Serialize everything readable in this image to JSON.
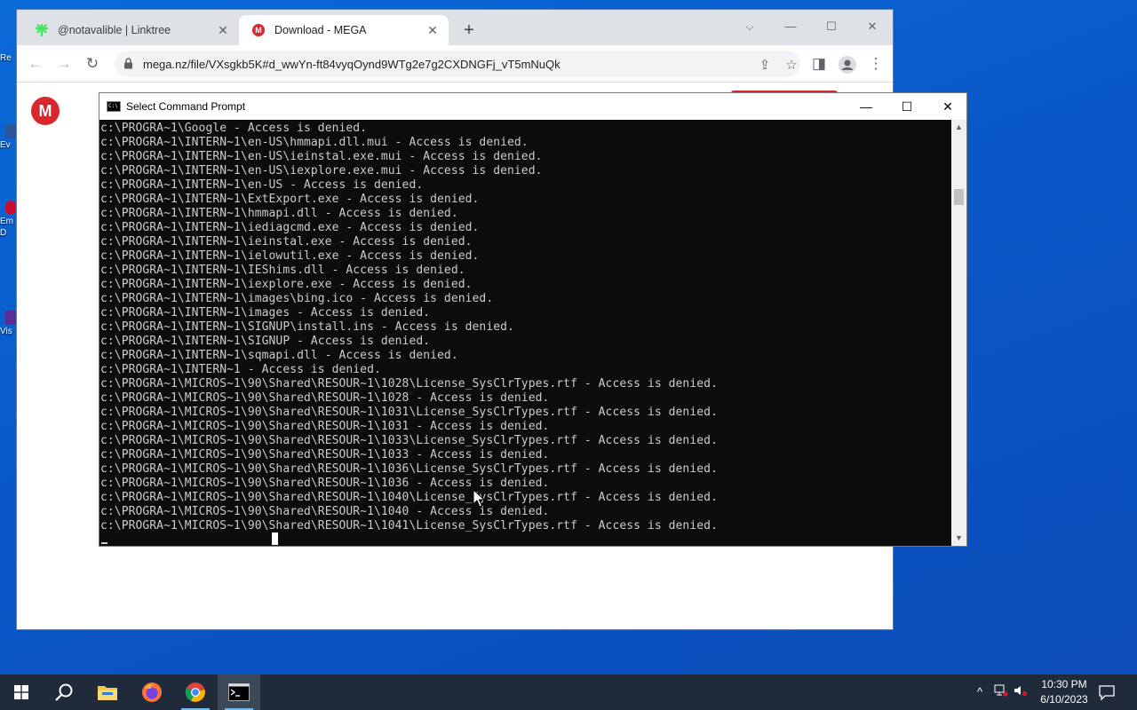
{
  "desktop": {
    "fragments": [
      "Re",
      "Ev",
      "Em",
      "D",
      "Vis"
    ]
  },
  "browser": {
    "tabs": [
      {
        "title": "@notavalible | Linktree",
        "favicon": "linktree-icon",
        "active": false
      },
      {
        "title": "Download - MEGA",
        "favicon": "mega-icon",
        "active": true
      }
    ],
    "new_tab_label": "+",
    "url": "mega.nz/file/VXsgkb5K#d_wwYn-ft84vyqOynd9WTg2e7g2CXDNGFj_vT5mNuQk",
    "page_logo": "M"
  },
  "cmd": {
    "title": "Select Command Prompt",
    "icon_text": "C:\\",
    "lines": [
      "c:\\PROGRA~1\\Google - Access is denied.",
      "c:\\PROGRA~1\\INTERN~1\\en-US\\hmmapi.dll.mui - Access is denied.",
      "c:\\PROGRA~1\\INTERN~1\\en-US\\ieinstal.exe.mui - Access is denied.",
      "c:\\PROGRA~1\\INTERN~1\\en-US\\iexplore.exe.mui - Access is denied.",
      "c:\\PROGRA~1\\INTERN~1\\en-US - Access is denied.",
      "c:\\PROGRA~1\\INTERN~1\\ExtExport.exe - Access is denied.",
      "c:\\PROGRA~1\\INTERN~1\\hmmapi.dll - Access is denied.",
      "c:\\PROGRA~1\\INTERN~1\\iediagcmd.exe - Access is denied.",
      "c:\\PROGRA~1\\INTERN~1\\ieinstal.exe - Access is denied.",
      "c:\\PROGRA~1\\INTERN~1\\ielowutil.exe - Access is denied.",
      "c:\\PROGRA~1\\INTERN~1\\IEShims.dll - Access is denied.",
      "c:\\PROGRA~1\\INTERN~1\\iexplore.exe - Access is denied.",
      "c:\\PROGRA~1\\INTERN~1\\images\\bing.ico - Access is denied.",
      "c:\\PROGRA~1\\INTERN~1\\images - Access is denied.",
      "c:\\PROGRA~1\\INTERN~1\\SIGNUP\\install.ins - Access is denied.",
      "c:\\PROGRA~1\\INTERN~1\\SIGNUP - Access is denied.",
      "c:\\PROGRA~1\\INTERN~1\\sqmapi.dll - Access is denied.",
      "c:\\PROGRA~1\\INTERN~1 - Access is denied.",
      "c:\\PROGRA~1\\MICROS~1\\90\\Shared\\RESOUR~1\\1028\\License_SysClrTypes.rtf - Access is denied.",
      "c:\\PROGRA~1\\MICROS~1\\90\\Shared\\RESOUR~1\\1028 - Access is denied.",
      "c:\\PROGRA~1\\MICROS~1\\90\\Shared\\RESOUR~1\\1031\\License_SysClrTypes.rtf - Access is denied.",
      "c:\\PROGRA~1\\MICROS~1\\90\\Shared\\RESOUR~1\\1031 - Access is denied.",
      "c:\\PROGRA~1\\MICROS~1\\90\\Shared\\RESOUR~1\\1033\\License_SysClrTypes.rtf - Access is denied.",
      "c:\\PROGRA~1\\MICROS~1\\90\\Shared\\RESOUR~1\\1033 - Access is denied.",
      "c:\\PROGRA~1\\MICROS~1\\90\\Shared\\RESOUR~1\\1036\\License_SysClrTypes.rtf - Access is denied.",
      "c:\\PROGRA~1\\MICROS~1\\90\\Shared\\RESOUR~1\\1036 - Access is denied.",
      "c:\\PROGRA~1\\MICROS~1\\90\\Shared\\RESOUR~1\\1040\\License_SysClrTypes.rtf - Access is denied.",
      "c:\\PROGRA~1\\MICROS~1\\90\\Shared\\RESOUR~1\\1040 - Access is denied.",
      "c:\\PROGRA~1\\MICROS~1\\90\\Shared\\RESOUR~1\\1041\\License_SysClrTypes.rtf - Access is denied."
    ]
  },
  "taskbar": {
    "apps": [
      "start-icon",
      "search-icon",
      "file-explorer-icon",
      "firefox-icon",
      "chrome-icon",
      "command-prompt-icon"
    ],
    "clock_time": "10:30 PM",
    "clock_date": "6/10/2023"
  },
  "colors": {
    "desktop_blue": "#0a5ed0",
    "mega_red": "#d9272e",
    "console_bg": "#0c0c0c",
    "console_text": "#cccccc",
    "taskbar_bg": "#1f2a3a"
  }
}
